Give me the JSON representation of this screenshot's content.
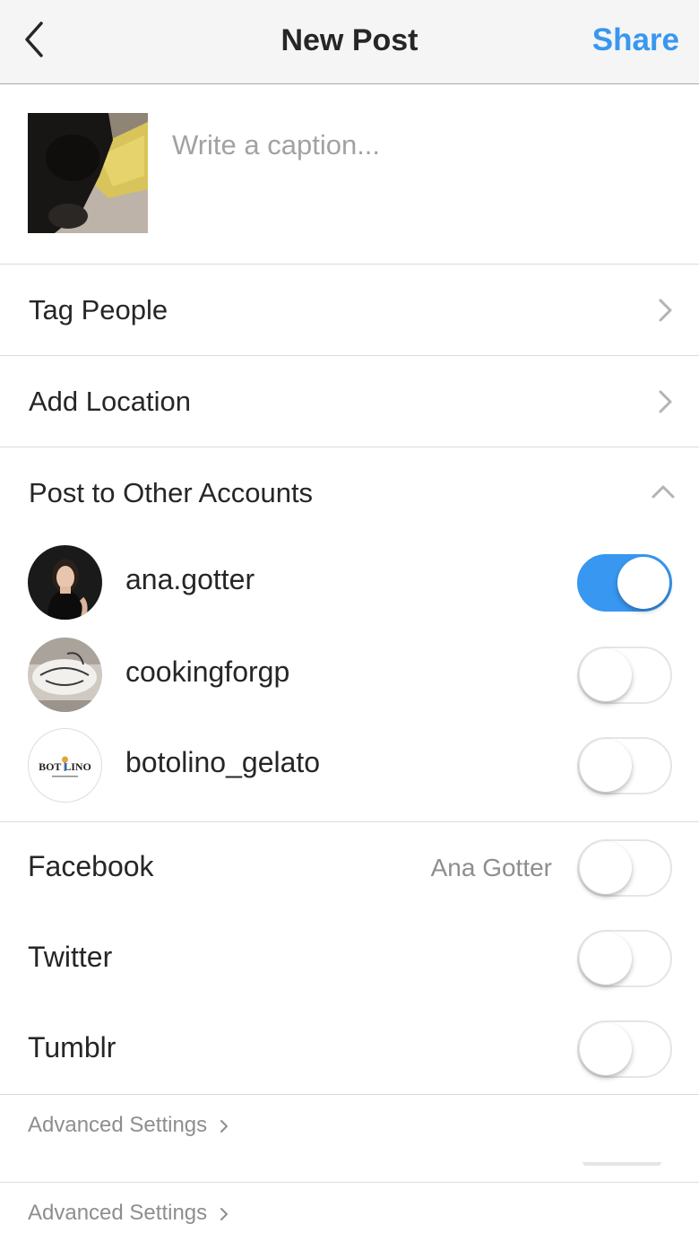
{
  "header": {
    "back_icon": "chevron-left-icon",
    "title": "New Post",
    "share_label": "Share",
    "share_color": "#3897f0"
  },
  "compose": {
    "caption_placeholder": "Write a caption..."
  },
  "options": {
    "tag_people": "Tag People",
    "add_location": "Add Location",
    "post_other_accounts": "Post to Other Accounts"
  },
  "accounts": [
    {
      "name": "ana.gotter",
      "enabled": true
    },
    {
      "name": "cookingforgp",
      "enabled": false
    },
    {
      "name": "botolino_gelato",
      "enabled": false,
      "logo_text": "BOT LINO"
    }
  ],
  "sharing": [
    {
      "label": "Facebook",
      "account": "Ana Gotter",
      "enabled": false
    },
    {
      "label": "Twitter",
      "enabled": false
    },
    {
      "label": "Tumblr",
      "enabled": false
    }
  ],
  "advanced": {
    "label_1": "Advanced Settings",
    "label_2": "Advanced Settings"
  },
  "colors": {
    "toggle_on": "#3897f0",
    "divider": "#dbdbdb"
  }
}
